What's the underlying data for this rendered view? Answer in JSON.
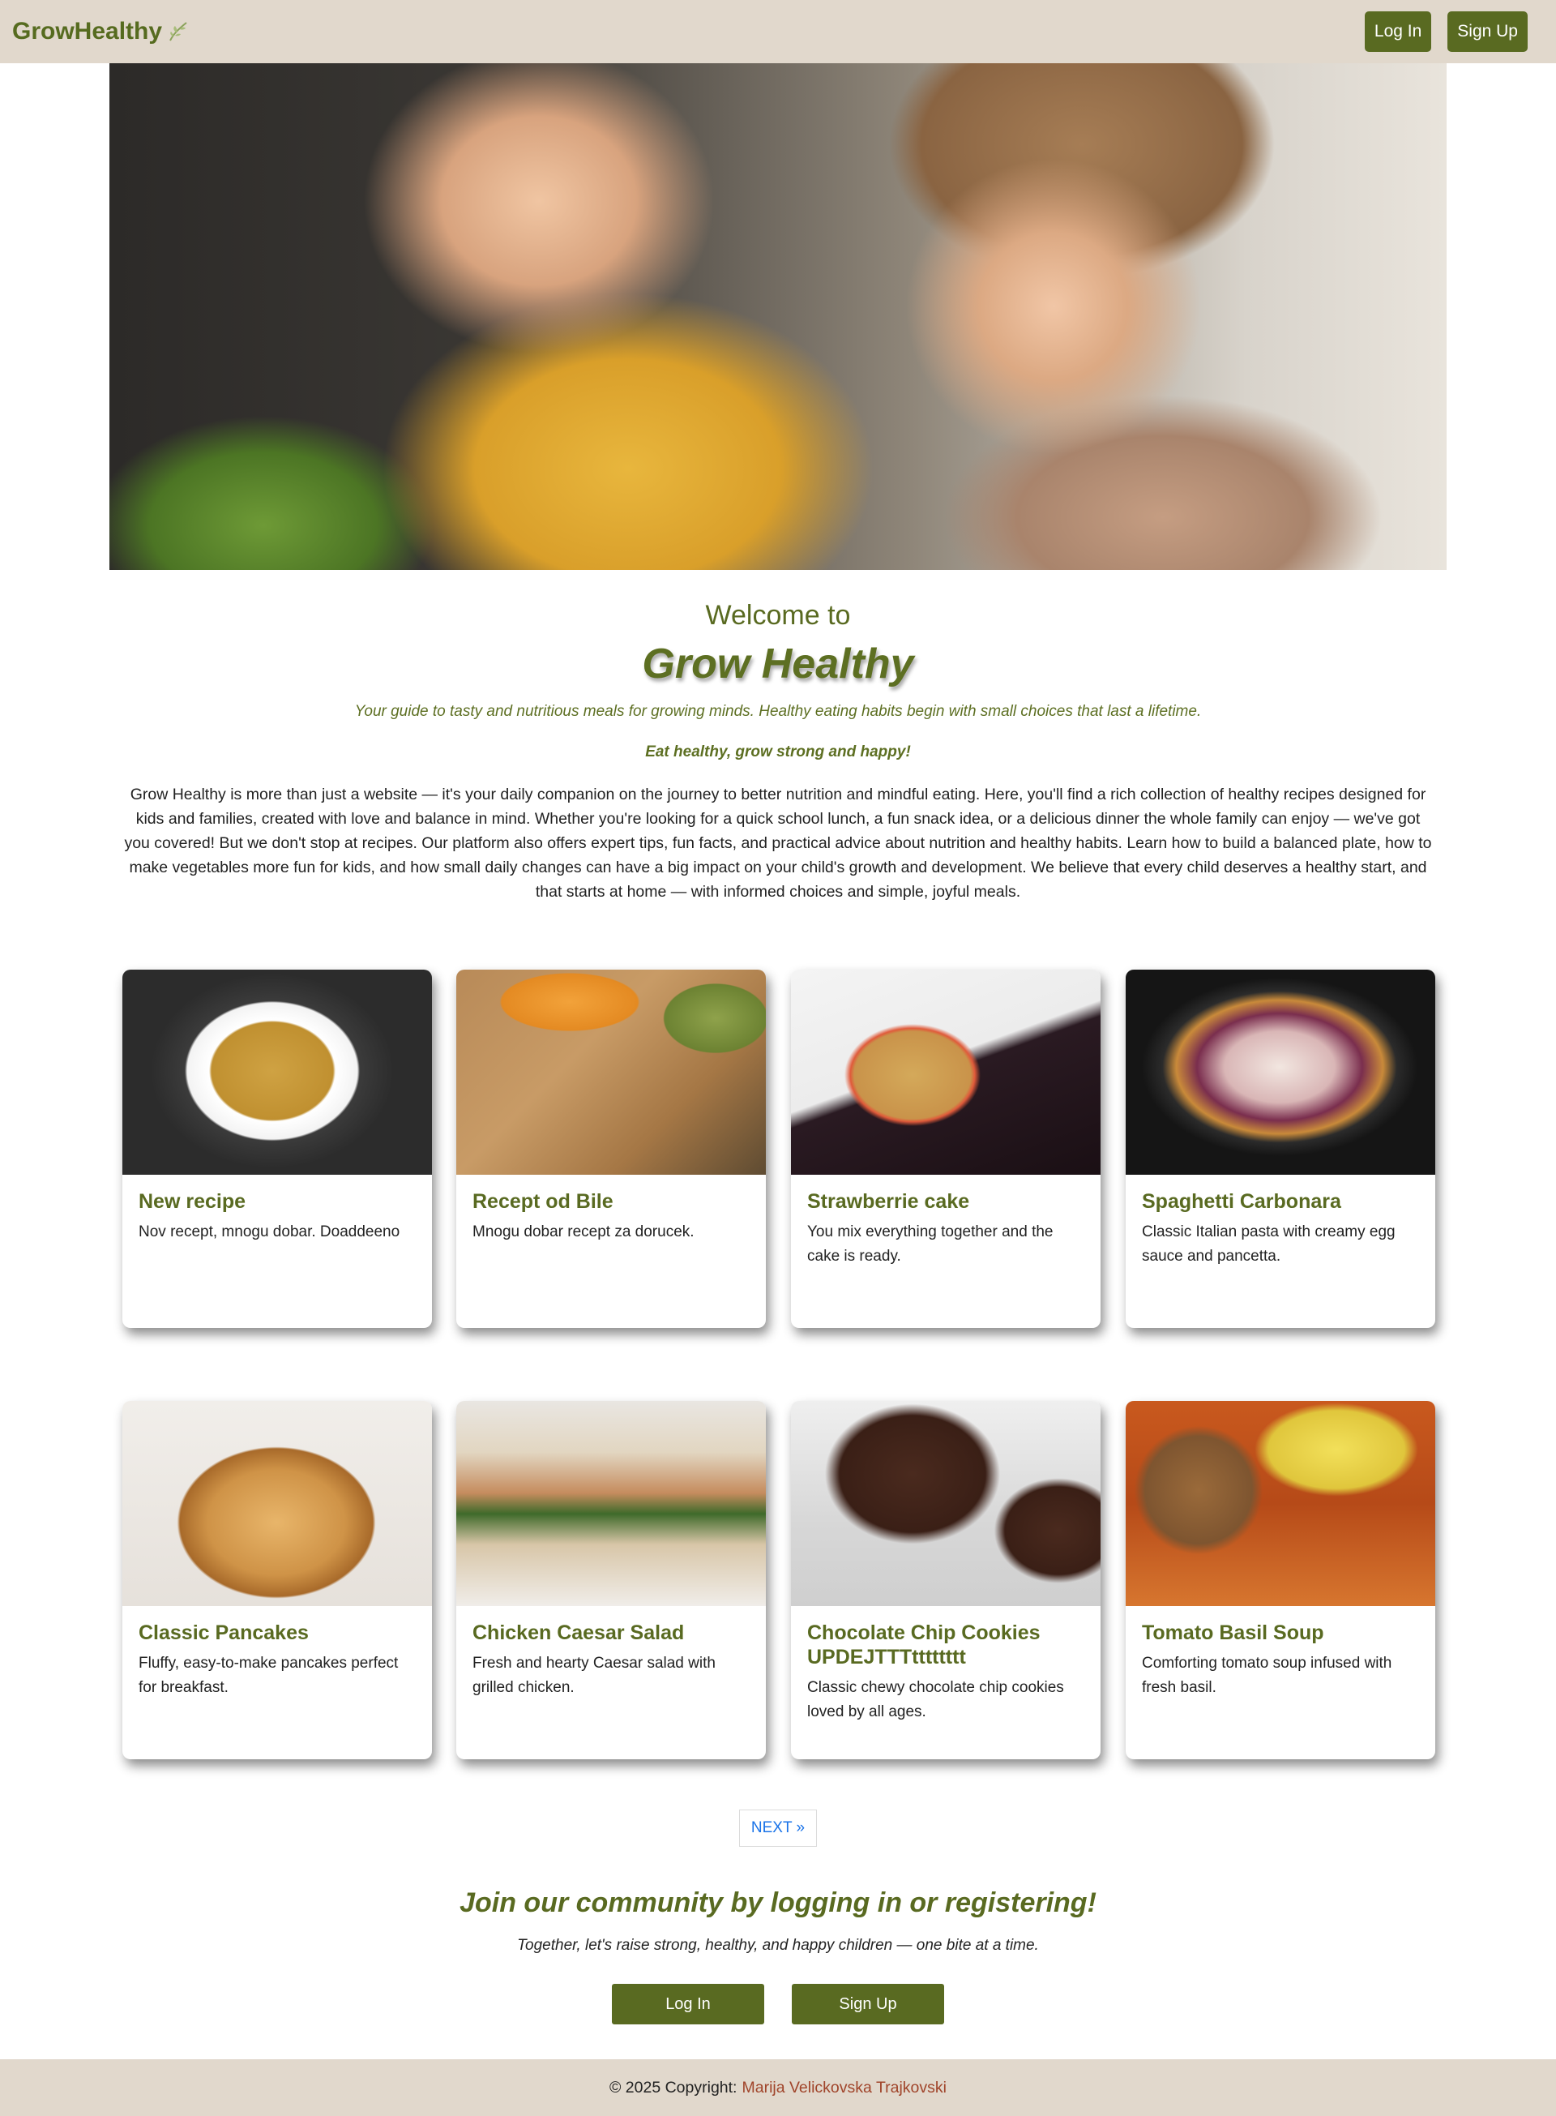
{
  "navbar": {
    "brand": "GrowHealthy",
    "login_label": "Log In",
    "signup_label": "Sign Up"
  },
  "welcome": {
    "pre": "Welcome to",
    "title": "Grow Healthy",
    "tagline": "Your guide to tasty and nutritious meals for growing minds. Healthy eating habits begin with small choices that last a lifetime.",
    "motto": "Eat healthy, grow strong and happy!",
    "about": "Grow Healthy is more than just a website — it's your daily companion on the journey to better nutrition and mindful eating. Here, you'll find a rich collection of healthy recipes designed for kids and families, created with love and balance in mind. Whether you're looking for a quick school lunch, a fun snack idea, or a delicious dinner the whole family can enjoy — we've got you covered! But we don't stop at recipes. Our platform also offers expert tips, fun facts, and practical advice about nutrition and healthy habits. Learn how to build a balanced plate, how to make vegetables more fun for kids, and how small daily changes can have a big impact on your child's growth and development. We believe that every child deserves a healthy start, and that starts at home — with informed choices and simple, joyful meals."
  },
  "recipes": [
    {
      "title": "New recipe",
      "desc": "Nov recept, mnogu dobar. Doaddeeno"
    },
    {
      "title": "Recept od Bile",
      "desc": "Mnogu dobar recept za dorucek."
    },
    {
      "title": "Strawberrie cake",
      "desc": "You mix everything together and the cake is ready."
    },
    {
      "title": "Spaghetti Carbonara",
      "desc": "Classic Italian pasta with creamy egg sauce and pancetta."
    },
    {
      "title": "Classic Pancakes",
      "desc": "Fluffy, easy-to-make pancakes perfect for breakfast."
    },
    {
      "title": "Chicken Caesar Salad",
      "desc": "Fresh and hearty Caesar salad with grilled chicken."
    },
    {
      "title": "Chocolate Chip Cookies UPDEJTTTtttttttt",
      "desc": "Classic chewy chocolate chip cookies loved by all ages."
    },
    {
      "title": "Tomato Basil Soup",
      "desc": "Comforting tomato soup infused with fresh basil."
    }
  ],
  "pagination": {
    "next_label": "NEXT »"
  },
  "join": {
    "title": "Join our community by logging in or registering!",
    "subtitle": "Together, let's raise strong, healthy, and happy children — one bite at a time.",
    "login_label": "Log In",
    "signup_label": "Sign Up"
  },
  "footer": {
    "copyright": "© 2025 Copyright:",
    "author": "Marija Velickovska Trajkovski"
  },
  "colors": {
    "accent": "#596a21",
    "navbar_bg": "#e1d8cc",
    "author_link": "#a0442a",
    "next_link": "#1a73e8"
  }
}
